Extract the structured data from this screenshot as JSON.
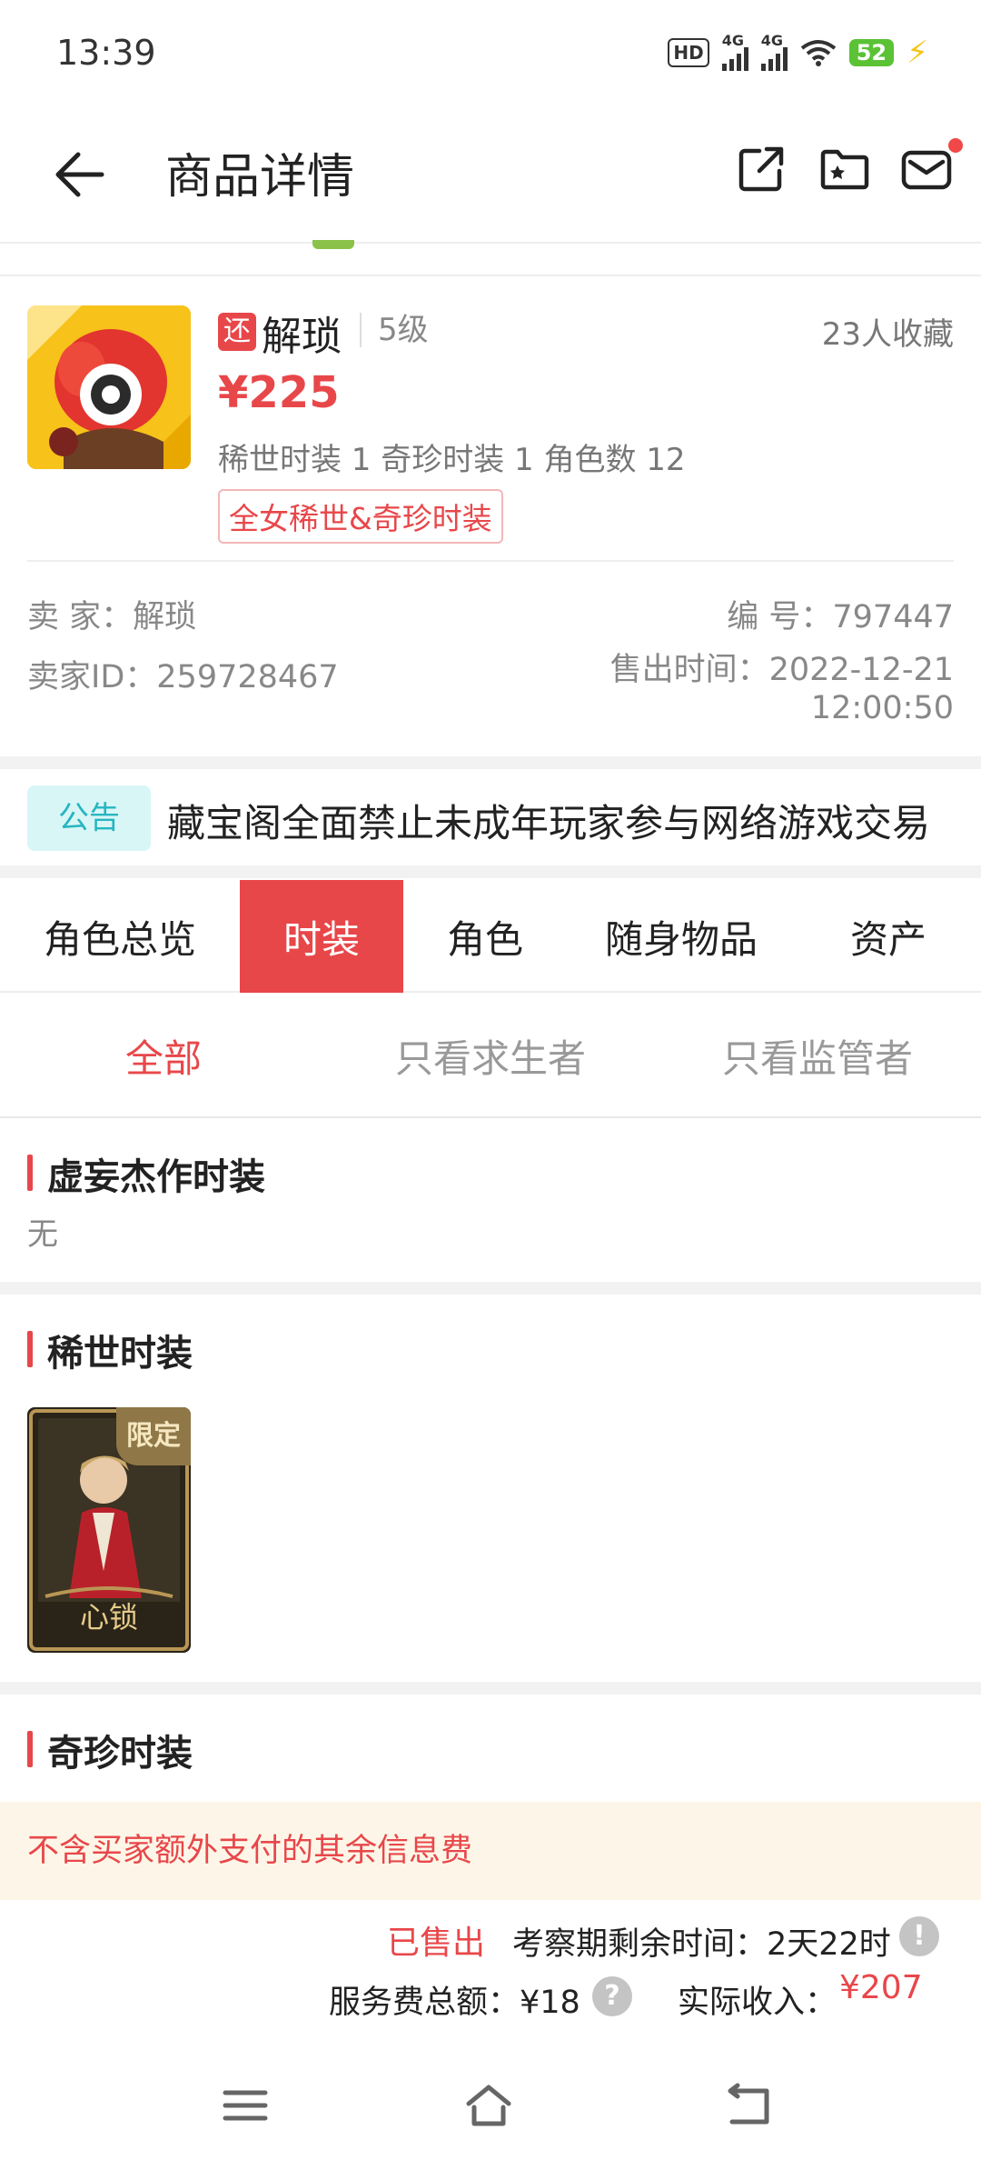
{
  "status_bar": {
    "time": "13:39",
    "hd": "HD",
    "net1": "4G",
    "net2": "4G",
    "battery": "52"
  },
  "header": {
    "title": "商品详情",
    "icons": [
      "back-icon",
      "share-icon",
      "favorite-folder-icon",
      "message-icon"
    ]
  },
  "product": {
    "tag": "还",
    "name": "解琐",
    "level": "5级",
    "favorites": "23人收藏",
    "price": "¥225",
    "counts": "稀世时装 1 奇珍时装 1 角色数 12",
    "label": "全女稀世&奇珍时装"
  },
  "seller": {
    "seller_label": "卖 家：",
    "seller_value": "解琐",
    "id_label": "卖家ID：",
    "id_value": "259728467",
    "number_label": "编 号：",
    "number_value": "797447",
    "sold_time_label": "售出时间：",
    "sold_time_date": "2022-12-21",
    "sold_time_clock": "12:00:50"
  },
  "notice": {
    "badge": "公告",
    "text": "藏宝阁全面禁止未成年玩家参与网络游戏交易"
  },
  "tabs": [
    {
      "label": "角色总览",
      "active": false
    },
    {
      "label": "时装",
      "active": true
    },
    {
      "label": "角色",
      "active": false
    },
    {
      "label": "随身物品",
      "active": false
    },
    {
      "label": "资产",
      "active": false
    }
  ],
  "subtabs": [
    {
      "label": "全部",
      "active": true
    },
    {
      "label": "只看求生者",
      "active": false
    },
    {
      "label": "只看监管者",
      "active": false
    }
  ],
  "sections": {
    "masterpiece_title": "虚妄杰作时装",
    "masterpiece_none": "无",
    "rare_title": "稀世时装",
    "rare_item_badge": "限定",
    "rare_item_name": "心锁",
    "treasure_title": "奇珍时装"
  },
  "footer": {
    "warning": "不含买家额外支付的其余信息费",
    "sold": "已售出",
    "remain": "考察期剩余时间：2天22时",
    "service_fee": "服务费总额：¥18",
    "income_label": "实际收入：",
    "income_value": "¥207"
  },
  "colors": {
    "accent": "#e8474a",
    "notice_badge_bg": "#d9f6f7",
    "notice_badge_text": "#26b6c0",
    "warning_bg": "#fdf6e8"
  }
}
